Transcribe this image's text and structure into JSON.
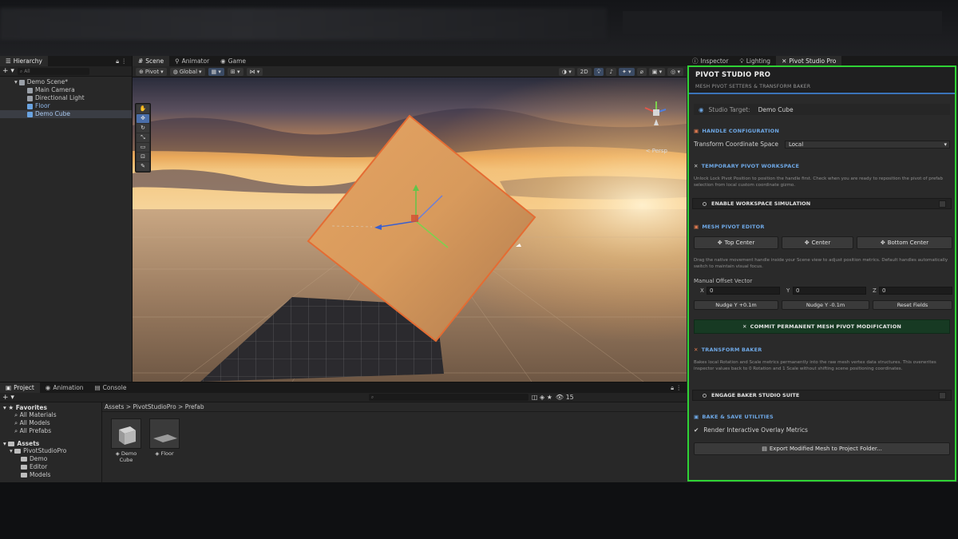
{
  "hierarchy": {
    "tab": "Hierarchy",
    "search_placeholder": "All",
    "scene": "Demo Scene*",
    "items": [
      "Main Camera",
      "Directional Light",
      "Floor",
      "Demo Cube"
    ]
  },
  "scene_tabs": [
    "Scene",
    "Animator",
    "Game"
  ],
  "scene_toolbar": {
    "pivot": "Pivot",
    "global": "Global",
    "mode_2d": "2D"
  },
  "viewport": {
    "persp_label": "< Persp"
  },
  "project": {
    "tabs": [
      "Project",
      "Animation",
      "Console"
    ],
    "favorites": {
      "label": "Favorites",
      "items": [
        "All Materials",
        "All Models",
        "All Prefabs"
      ]
    },
    "assets": {
      "label": "Assets",
      "root": "PivotStudioPro",
      "folders": [
        "Demo",
        "Editor",
        "Models"
      ]
    },
    "breadcrumb": "Assets > PivotStudioPro > Prefab",
    "files": [
      "Demo Cube",
      "Floor"
    ],
    "count": "15"
  },
  "inspector": {
    "tabs": [
      "Inspector",
      "Lighting",
      "Pivot Studio Pro"
    ],
    "title": "PIVOT STUDIO PRO",
    "subtitle": "MESH PIVOT SETTERS & TRANSFORM BAKER",
    "target_label": "Studio Target:",
    "target_value": "Demo Cube",
    "handle_section": "HANDLE CONFIGURATION",
    "coord_label": "Transform Coordinate Space",
    "coord_value": "Local",
    "workspace_section": "TEMPORARY PIVOT WORKSPACE",
    "workspace_desc": "Unlock Lock Pivot Position to position the handle first. Check when you are ready to reposition the pivot of prefab selection from local custom coordinate gizmo.",
    "workspace_toggle": "ENABLE WORKSPACE SIMULATION",
    "mesh_section": "MESH PIVOT EDITOR",
    "btn_top": "Top Center",
    "btn_center": "Center",
    "btn_bottom": "Bottom Center",
    "mesh_desc": "Drag the native movement handle inside your Scene view to adjust position metrics. Default handles automatically switch to maintain visual focus.",
    "offset_label": "Manual Offset Vector",
    "offset": {
      "x": "0",
      "y": "0",
      "z": "0"
    },
    "nudge_up": "Nudge Y +0.1m",
    "nudge_down": "Nudge Y -0.1m",
    "reset": "Reset Fields",
    "commit": "COMMIT PERMANENT MESH PIVOT MODIFICATION",
    "bake_section": "TRANSFORM BAKER",
    "bake_desc": "Bakes local Rotation and Scale metrics permanently into the raw mesh vertex data structures. This overwrites inspector values back to 0 Rotation and 1 Scale without shifting scene positioning coordinates.",
    "bake_toggle": "ENGAGE BAKER STUDIO SUITE",
    "save_section": "BAKE & SAVE UTILITIES",
    "overlay_label": "Render Interactive Overlay Metrics",
    "export": "Export Modified Mesh to Project Folder..."
  },
  "colors": {
    "accent_green": "#2fd335",
    "accent_blue": "#6ea8e6",
    "commit_bg": "#173a23"
  }
}
